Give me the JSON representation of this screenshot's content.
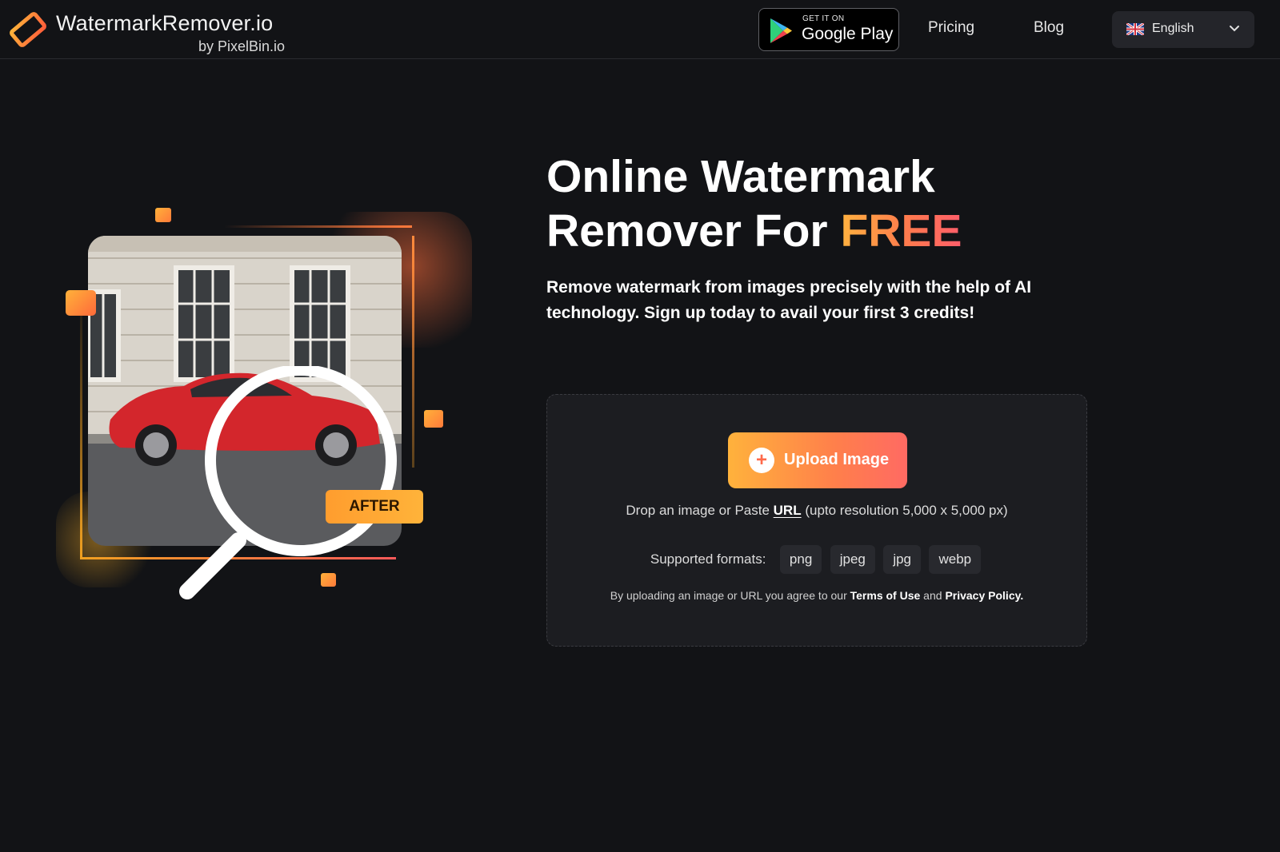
{
  "header": {
    "logo_title": "WatermarkRemover.io",
    "logo_subtitle": "by PixelBin.io",
    "google_play": {
      "small": "GET IT ON",
      "big": "Google Play"
    },
    "nav": {
      "pricing": "Pricing",
      "blog": "Blog"
    },
    "language": {
      "selected": "English",
      "flag": "uk-flag-icon"
    }
  },
  "hero": {
    "title_line1": "Online Watermark",
    "title_line2_prefix": "Remover For ",
    "title_line2_highlight": "FREE",
    "subtitle": "Remove watermark from images precisely with the help of AI technology. Sign up today to avail your first 3 credits!"
  },
  "illustration": {
    "badge": "AFTER"
  },
  "upload": {
    "button_label": "Upload Image",
    "drop_prefix": "Drop an image or Paste ",
    "drop_link": "URL",
    "drop_suffix": " (upto resolution 5,000 x 5,000 px)",
    "formats_label": "Supported formats:",
    "formats": [
      "png",
      "jpeg",
      "jpg",
      "webp"
    ],
    "legal_prefix": "By uploading an image or URL you agree to our ",
    "terms": "Terms of Use",
    "legal_and": " and ",
    "privacy": "Privacy Policy."
  },
  "colors": {
    "background": "#121316",
    "card": "#1c1d21",
    "accent_start": "#ffb23c",
    "accent_end": "#ff6a63"
  }
}
